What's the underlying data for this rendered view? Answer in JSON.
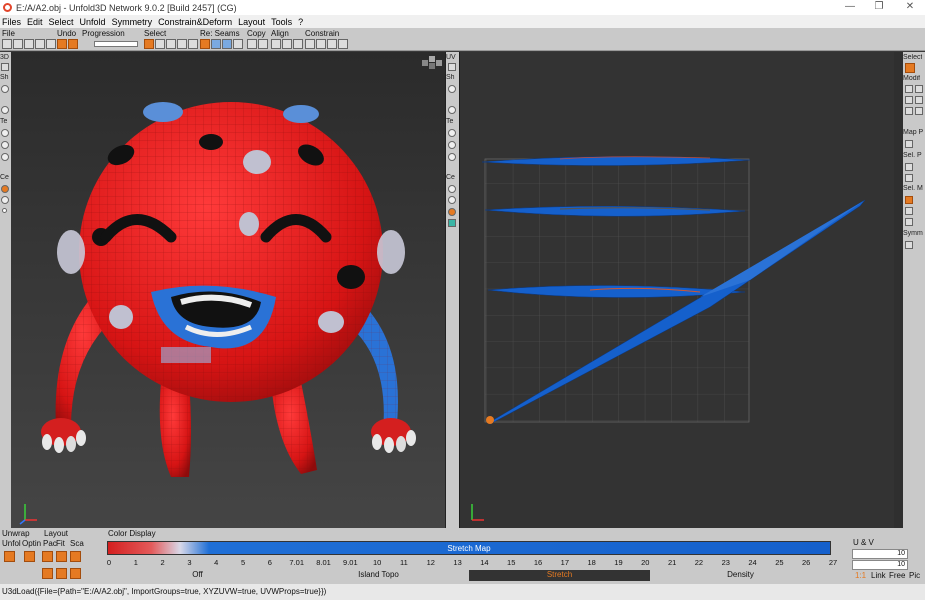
{
  "window": {
    "title": "E:/A/A2.obj - Unfold3D Network 9.0.2 [Build 2457] (CG)"
  },
  "menu": [
    "Files",
    "Edit",
    "Select",
    "Unfold",
    "Symmetry",
    "Constrain&Deform",
    "Layout",
    "Tools",
    "?"
  ],
  "toolbar": {
    "groups": [
      "File",
      "Undo",
      "Progression",
      "Select",
      "Re: Seams",
      "Copy",
      "Align",
      "Constrain"
    ]
  },
  "left_strip": {
    "labels": [
      "3D",
      "Sh",
      "Te",
      "Ce"
    ]
  },
  "mid_strip": {
    "labels": [
      "UV",
      "Sh",
      "Te",
      "Ce"
    ]
  },
  "right_tools": {
    "labels": [
      "Select",
      "Modif",
      "Map P",
      "Sel. P",
      "Sel. M",
      "Symm"
    ]
  },
  "bottom": {
    "unwrap_label": "Unwrap",
    "layout_label": "Layout",
    "color_display_label": "Color Display",
    "uv_label": "U & V",
    "left_row": [
      "Unfol",
      "Optin",
      "Pac",
      "Fit",
      "Sca"
    ],
    "stretch_map_label": "Stretch Map",
    "ticks": [
      "0",
      "1",
      "2",
      "3",
      "4",
      "5",
      "6",
      "7.01",
      "8.01",
      "9.01",
      "10",
      "11",
      "12",
      "13",
      "14",
      "15",
      "16",
      "17",
      "18",
      "19",
      "20",
      "21",
      "22",
      "23",
      "24",
      "25",
      "26",
      "27"
    ],
    "modes": [
      "Off",
      "Island Topo",
      "Stretch",
      "Density"
    ],
    "active_mode": "Stretch",
    "ratio": "1:1",
    "right_buttons": [
      "Link",
      "Free",
      "Pic"
    ],
    "field_values": [
      "10",
      "10"
    ]
  },
  "status": {
    "command": "U3dLoad({File={Path=\"E:/A/A2.obj\", ImportGroups=true, XYZUVW=true, UVWProps=true}})"
  },
  "colors": {
    "accent": "#e57a22",
    "stretch_red": "#d41f1f",
    "stretch_blue": "#1560cc"
  }
}
